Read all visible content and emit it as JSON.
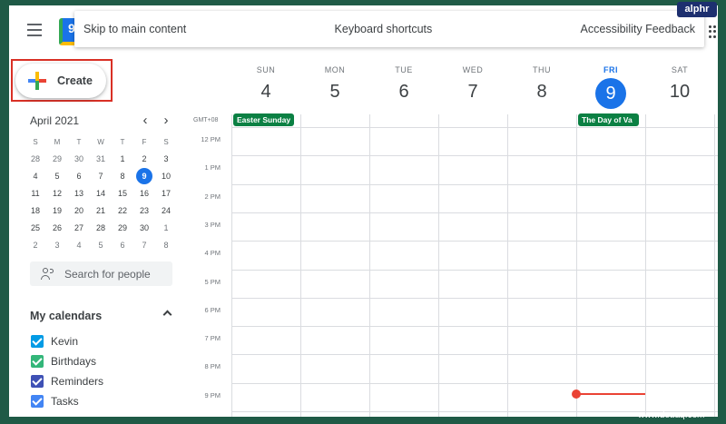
{
  "skip_bar": {
    "skip": "Skip to main content",
    "shortcuts": "Keyboard shortcuts",
    "feedback": "Accessibility Feedback"
  },
  "logo_glyph": "9",
  "create_label": "Create",
  "mini_calendar": {
    "title": "April 2021",
    "prev": "‹",
    "next": "›",
    "dow": [
      "S",
      "M",
      "T",
      "W",
      "T",
      "F",
      "S"
    ],
    "weeks": [
      [
        "28",
        "29",
        "30",
        "31",
        "1",
        "2",
        "3"
      ],
      [
        "4",
        "5",
        "6",
        "7",
        "8",
        "9",
        "10"
      ],
      [
        "11",
        "12",
        "13",
        "14",
        "15",
        "16",
        "17"
      ],
      [
        "18",
        "19",
        "20",
        "21",
        "22",
        "23",
        "24"
      ],
      [
        "25",
        "26",
        "27",
        "28",
        "29",
        "30",
        "1"
      ],
      [
        "2",
        "3",
        "4",
        "5",
        "6",
        "7",
        "8"
      ]
    ],
    "today": "9"
  },
  "search_people_placeholder": "Search for people",
  "my_calendars": {
    "title": "My calendars",
    "items": [
      {
        "label": "Kevin",
        "color": "#039be5"
      },
      {
        "label": "Birthdays",
        "color": "#33b679"
      },
      {
        "label": "Reminders",
        "color": "#3f51b5"
      },
      {
        "label": "Tasks",
        "color": "#4285f4"
      }
    ]
  },
  "week": {
    "timezone": "GMT+08",
    "days": [
      {
        "dow": "SUN",
        "num": "4"
      },
      {
        "dow": "MON",
        "num": "5"
      },
      {
        "dow": "TUE",
        "num": "6"
      },
      {
        "dow": "WED",
        "num": "7"
      },
      {
        "dow": "THU",
        "num": "8"
      },
      {
        "dow": "FRI",
        "num": "9",
        "today": true
      },
      {
        "dow": "SAT",
        "num": "10"
      }
    ],
    "all_day_events": [
      {
        "title": "Easter Sunday",
        "day": 0,
        "color": "#0b8043"
      },
      {
        "title": "The Day of Va",
        "day": 5,
        "color": "#0b8043"
      }
    ],
    "hours": [
      "12 PM",
      "1 PM",
      "2 PM",
      "3 PM",
      "4 PM",
      "5 PM",
      "6 PM",
      "7 PM",
      "8 PM",
      "9 PM"
    ]
  },
  "watermarks": {
    "brand": "alphr",
    "site": "www.deuaq.com"
  }
}
